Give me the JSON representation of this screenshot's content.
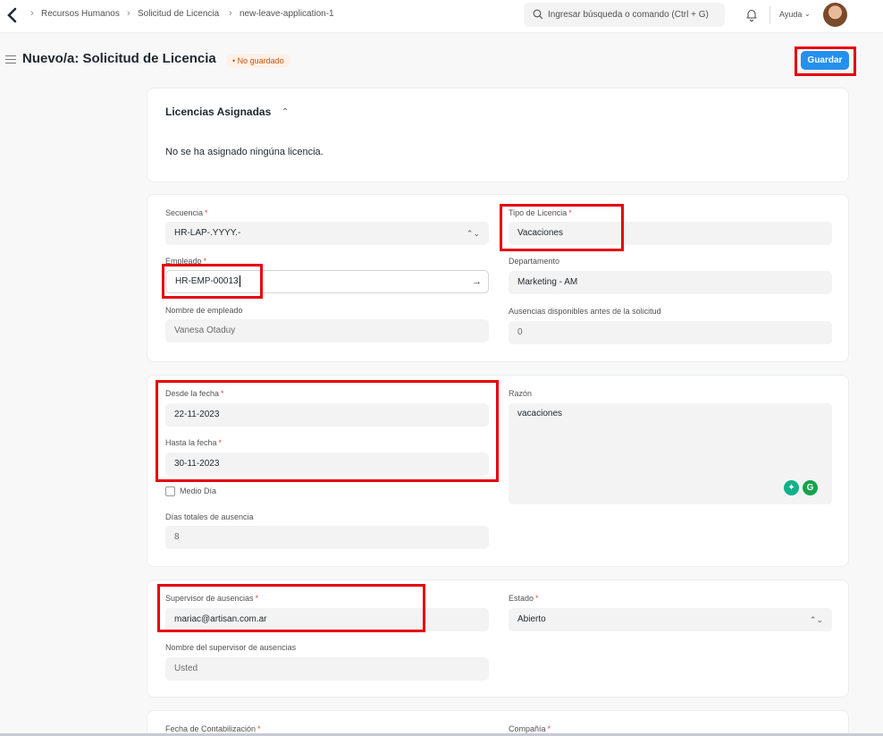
{
  "breadcrumb": {
    "items": [
      "Recursos Humanos",
      "Solicitud de Licencia",
      "new-leave-application-1"
    ]
  },
  "search": {
    "placeholder": "Ingresar búsqueda o comando (Ctrl + G)"
  },
  "navbar": {
    "help_label": "Ayuda"
  },
  "header": {
    "title": "Nuevo/a: Solicitud de Licencia",
    "status": "No guardado",
    "save_label": "Guardar"
  },
  "allocated": {
    "title": "Licencias Asignadas",
    "empty_message": "No se ha asignado ningúna licencia."
  },
  "employee_section": {
    "series": {
      "label": "Secuencia",
      "value": "HR-LAP-.YYYY.-"
    },
    "leave_type": {
      "label": "Tipo de Licencia",
      "value": "Vacaciones"
    },
    "employee": {
      "label": "Empleado",
      "value": "HR-EMP-00013"
    },
    "department": {
      "label": "Departamento",
      "value": "Marketing - AM"
    },
    "employee_name": {
      "label": "Nombre de empleado",
      "value": "Vanesa Otaduy"
    },
    "leave_balance": {
      "label": "Ausencias disponibles antes de la solicitud",
      "value": "0"
    }
  },
  "dates_section": {
    "from_date": {
      "label": "Desde la fecha",
      "value": "22-11-2023"
    },
    "to_date": {
      "label": "Hasta la fecha",
      "value": "30-11-2023"
    },
    "half_day": {
      "label": "Medio Día",
      "checked": false
    },
    "total_days": {
      "label": "Días totales de ausencia",
      "value": "8"
    },
    "reason": {
      "label": "Razón",
      "value": "vacaciones"
    }
  },
  "approver_section": {
    "approver": {
      "label": "Supervisor de ausencias",
      "value": "mariac@artisan.com.ar"
    },
    "status": {
      "label": "Estado",
      "value": "Abierto"
    },
    "approver_name": {
      "label": "Nombre del supervisor de ausencias",
      "value": "Usted"
    }
  },
  "posting_section": {
    "posting_date": {
      "label": "Fecha de Contabilización"
    },
    "company": {
      "label": "Compañía"
    }
  },
  "colors": {
    "primary": "#2490ef",
    "highlight": "#e6000a",
    "unsaved_bg": "#fff1e7",
    "unsaved_text": "#c05912"
  }
}
